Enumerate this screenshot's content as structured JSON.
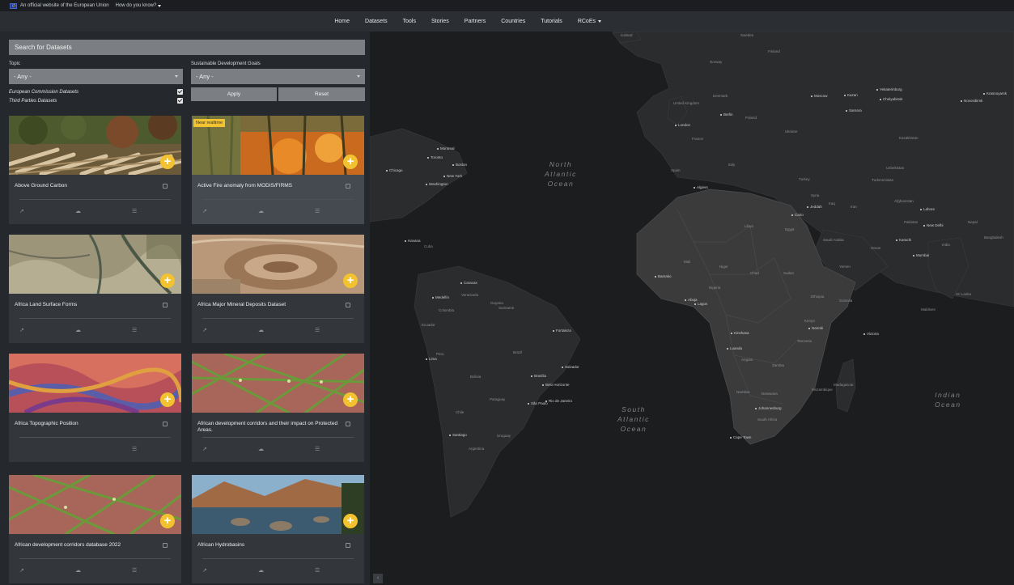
{
  "eu_bar": {
    "official_text": "An official website of the European Union",
    "how_text": "How do you know?"
  },
  "nav": {
    "items": [
      "Home",
      "Datasets",
      "Tools",
      "Stories",
      "Partners",
      "Countries",
      "Tutorials"
    ],
    "rcoes": "RCoEs"
  },
  "filters": {
    "search_placeholder": "Search for Datasets",
    "topic_label": "Topic",
    "topic_value": "- Any -",
    "sdg_label": "Sustainable Development Goals",
    "sdg_value": "- Any -",
    "check_ec": "European Commission Datasets",
    "check_third": "Third Parties Datasets",
    "apply": "Apply",
    "reset": "Reset"
  },
  "cards": [
    {
      "title": "Above Ground Carbon"
    },
    {
      "title": "Active Fire anomaly from MODIS/FIRMS",
      "badge": "Near realtime"
    },
    {
      "title": "Africa Land Surface Forms"
    },
    {
      "title": "Africa Major Mineral Deposits Dataset"
    },
    {
      "title": "Africa Topographic Position"
    },
    {
      "title": "African development corridors and their impact on Protected Areas."
    },
    {
      "title": "African development corridors database 2022"
    },
    {
      "title": "African Hydrobasins"
    }
  ],
  "map": {
    "oceans": {
      "north_atlantic": "North\nAtlantic\nOcean",
      "south_atlantic": "South\nAtlantic\nOcean",
      "indian": "Indian\nOcean"
    },
    "cities": [
      "Montreal",
      "Toronto",
      "Boston",
      "Chicago",
      "New York",
      "Washington",
      "Havana",
      "Caracas",
      "Medellín",
      "Lima",
      "Brasília",
      "Salvador",
      "Belo Horizonte",
      "São Paulo",
      "Rio de Janeiro",
      "Fortaleza",
      "Santiago",
      "London",
      "Berlin",
      "Moscow",
      "Kazan",
      "Samara",
      "Yekaterinburg",
      "Chelyabinsk",
      "Novosibirsk",
      "Krasnoyarsk",
      "Algiers",
      "Cairo",
      "Jeddah",
      "Karachi",
      "New Delhi",
      "Lahore",
      "Mumbai",
      "Bamako",
      "Abuja",
      "Lagos",
      "Kinshasa",
      "Luanda",
      "Nairobi",
      "Victoria",
      "Johannesburg",
      "Cape Town"
    ],
    "countries": [
      "Iceland",
      "Sweden",
      "Finland",
      "Norway",
      "Denmark",
      "United Kingdom",
      "Poland",
      "Ukraine",
      "France",
      "Spain",
      "Italy",
      "Turkey",
      "Kazakhstan",
      "Uzbekistan",
      "Turkmenistan",
      "Afghanistan",
      "Pakistan",
      "Iran",
      "Iraq",
      "Syria",
      "Saudi Arabia",
      "Oman",
      "Yemen",
      "India",
      "Nepal",
      "Bangladesh",
      "Sri Lanka",
      "Maldives",
      "Libya",
      "Egypt",
      "Sudan",
      "Ethiopia",
      "Somalia",
      "Kenya",
      "Tanzania",
      "Niger",
      "Nigeria",
      "Mali",
      "Chad",
      "Angola",
      "Zambia",
      "Namibia",
      "Botswana",
      "South Africa",
      "Mozambique",
      "Madagascar",
      "Cuba",
      "Venezuela",
      "Colombia",
      "Ecuador",
      "Peru",
      "Brazil",
      "Bolivia",
      "Paraguay",
      "Chile",
      "Argentina",
      "Uruguay",
      "Guyana",
      "Suriname"
    ],
    "collapse_icon": "‹"
  },
  "colors": {
    "accent": "#f2c230",
    "panel": "#25292d",
    "card": "#33373b",
    "map": "#1c1d1e",
    "land": "#3a3a3a"
  }
}
